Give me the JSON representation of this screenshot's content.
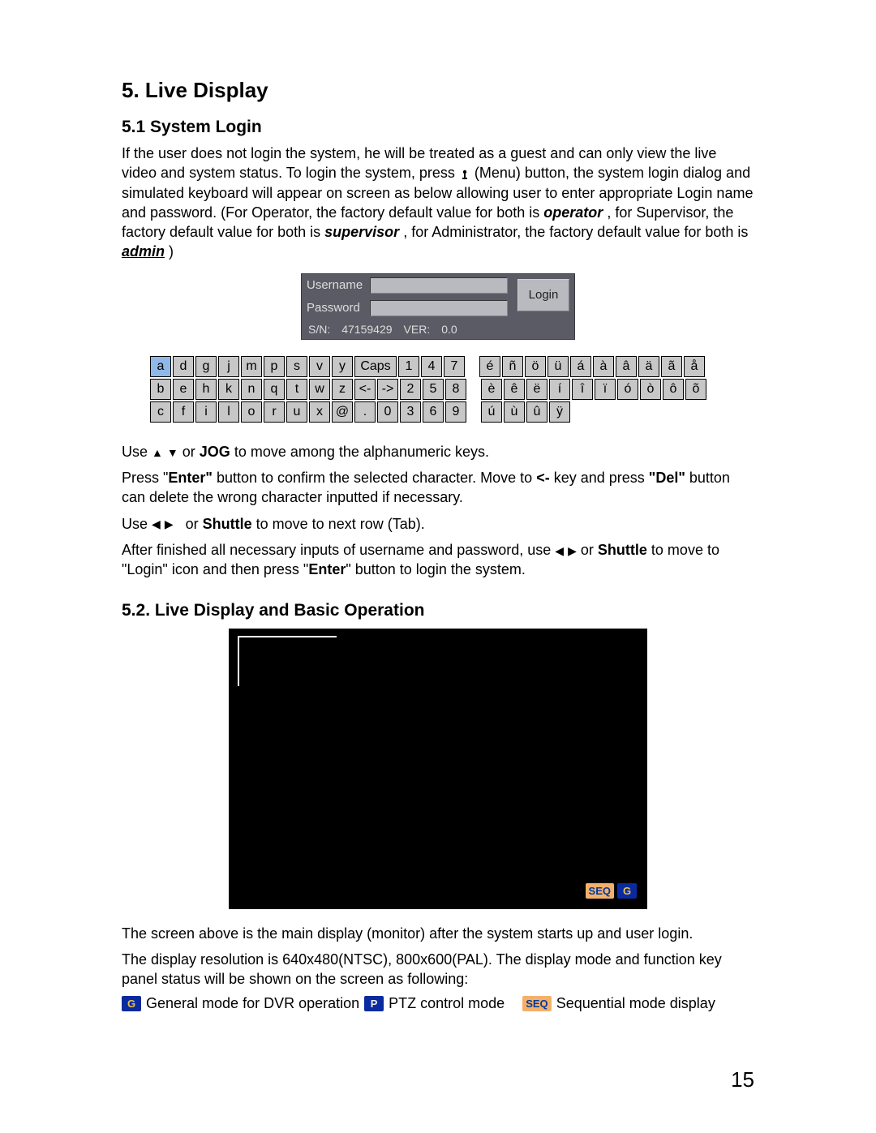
{
  "headings": {
    "h1": "5.  Live Display",
    "h2a": "5.1 System Login",
    "h2b": "5.2. Live Display and Basic Operation"
  },
  "p1": {
    "t1": "If the user does not login the system, he will be treated as a guest and can only view the live video and system status. To login the system, press ",
    "t2": " (Menu) button, the system login dialog and simulated keyboard will appear on screen as below allowing user to enter appropriate Login name and password. (For Operator, the factory default value for both is ",
    "op": "operator",
    "t3": ", for Supervisor, the factory default value for both is ",
    "sup": "supervisor",
    "t4": ", for Administrator, the factory default value for both is ",
    "adm": "admin",
    "t5": ")"
  },
  "login": {
    "user_label": "Username",
    "pass_label": "Password",
    "btn": "Login",
    "sn_label": "S/N:",
    "sn_val": "47159429",
    "ver_label": "VER:",
    "ver_val": "0.0"
  },
  "keyboard": {
    "row1_left": [
      "a",
      "d",
      "g",
      "j",
      "m",
      "p",
      "s",
      "v",
      "y"
    ],
    "row1_caps": "Caps",
    "row1_nums": [
      "1",
      "4",
      "7"
    ],
    "row1_right": [
      "é",
      "ñ",
      "ö",
      "ü",
      "á",
      "à",
      "â",
      "ä",
      "ã",
      "å"
    ],
    "row2_left": [
      "b",
      "e",
      "h",
      "k",
      "n",
      "q",
      "t",
      "w",
      "z"
    ],
    "row2_arrows": [
      "<-",
      "->"
    ],
    "row2_nums": [
      "2",
      "5",
      "8"
    ],
    "row2_right": [
      "è",
      "ê",
      "ë",
      "í",
      "î",
      "ï",
      "ó",
      "ò",
      "ô",
      "õ"
    ],
    "row3_left": [
      "c",
      "f",
      "i",
      "l",
      "o",
      "r",
      "u",
      "x",
      "@"
    ],
    "row3_dot": ".",
    "row3_nums": [
      "0",
      "3",
      "6",
      "9"
    ],
    "row3_right": [
      "ú",
      "ù",
      "û",
      "ÿ"
    ]
  },
  "instr": {
    "l1a": "Use ",
    "l1b": " or ",
    "jog": "JOG",
    "l1c": "  to move among the alphanumeric keys.",
    "l2a": "Press \"",
    "enter": "Enter\"",
    "l2b": " button to confirm the selected character. Move to ",
    "lt": "<-",
    "l2c": " key and press ",
    "del": "\"Del\"",
    "l2d": " button can delete the wrong character inputted if necessary.",
    "l3a": "Use ",
    "shuttle": "Shuttle",
    "l3b": " to move to next row (Tab).",
    "l4a": "After finished all necessary inputs of username and password, use ",
    "l4b": " or ",
    "l4c": " to move to \"Login\" icon and then press \"",
    "enter2": "Enter",
    "l4d": "\" button to login the system."
  },
  "p2": {
    "t1": "The screen above is the main display (monitor) after the system starts up and user login.",
    "t2": "The display resolution is 640x480(NTSC), 800x600(PAL). The display mode and function key panel status will be shown on the screen as following:"
  },
  "badges": {
    "seq": "SEQ",
    "g": "G",
    "p": "P"
  },
  "legend": {
    "g": " General mode for DVR operation ",
    "p": " PTZ control mode",
    "seq": " Sequential mode display"
  },
  "page": "15"
}
